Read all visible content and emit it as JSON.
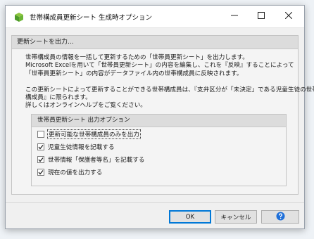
{
  "window": {
    "title": "世帯構成員更新シート 生成時オプション"
  },
  "section": {
    "header": "更新シートを出力..."
  },
  "description": {
    "lines": [
      "世帯構成員の情報を一括して更新するための「世帯員更新シート」を出力します。",
      "Microsoft Excelを用いて「世帯員更新シート」の内容を編集し、これを『反映』することによって",
      "「世帯員更新シート」の内容がデータファイル内の世帯構成員に反映されます。",
      "",
      "この更新シートによって更新することができる世帯構成員は、『支弁区分が「未決定」である児童生徒の世帯",
      "構成員』に限られます。",
      "詳しくはオンラインヘルプをご覧ください。"
    ]
  },
  "options": {
    "header": "世帯員更新シート 出力オプション",
    "items": [
      {
        "label": "更新可能な世帯構成員のみを出力",
        "checked": false
      },
      {
        "label": "児童生徒情報を記載する",
        "checked": true
      },
      {
        "label": "世帯情報「保護者等名」を記載する",
        "checked": true
      },
      {
        "label": "現在の値を出力する",
        "checked": true
      }
    ]
  },
  "buttons": {
    "ok": "OK",
    "cancel": "キャンセル",
    "help_icon": "help-icon"
  },
  "colors": {
    "accent": "#0078d7",
    "help": "#1e6fd9"
  }
}
